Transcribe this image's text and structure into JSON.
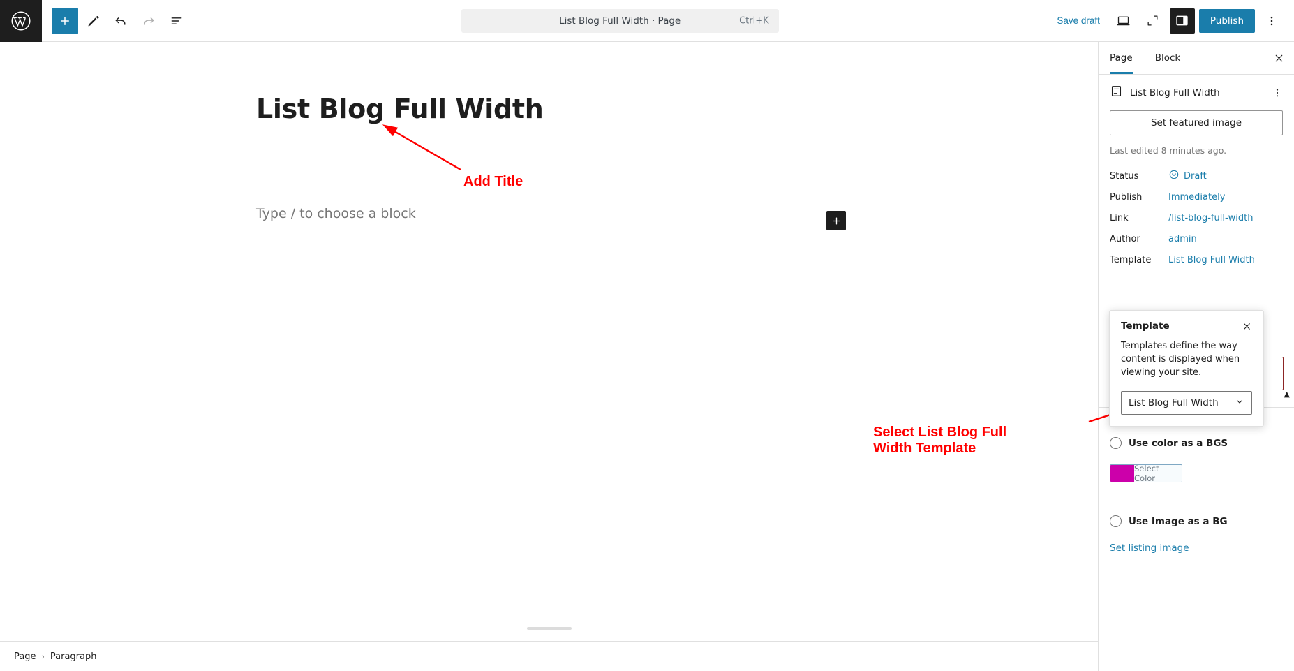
{
  "topbar": {
    "logo_icon": "wordpress-logo-icon",
    "add_block_icon": "plus-icon",
    "tools_icon": "pencil-icon",
    "undo_icon": "undo-arrow-icon",
    "redo_icon": "redo-arrow-icon",
    "list_view_icon": "list-view-icon",
    "document_title": "List Blog Full Width · Page",
    "command_shortcut": "Ctrl+K",
    "save_draft_label": "Save draft",
    "view_icon": "desktop-preview-icon",
    "fullscreen_icon": "expand-arrows-icon",
    "settings_icon": "settings-sidebar-icon",
    "publish_label": "Publish",
    "more_icon": "kebab-menu-icon"
  },
  "editor": {
    "post_title": "List Blog Full Width",
    "paragraph_placeholder": "Type / to choose a block",
    "block_inserter_icon": "plus-icon"
  },
  "annotations": [
    {
      "text": "Add Title",
      "color": "#ff0000"
    },
    {
      "text": "Select List Blog Full\nWidth Template",
      "line1": "Select List Blog Full",
      "line2": "Width Template",
      "color": "#ff0000"
    }
  ],
  "statusbar": {
    "breadcrumb": [
      "Page",
      "Paragraph"
    ],
    "separator": "›"
  },
  "sidebar": {
    "tabs": [
      {
        "label": "Page",
        "active": true
      },
      {
        "label": "Block",
        "active": false
      }
    ],
    "close_icon": "close-x-icon",
    "document_icon": "page-document-icon",
    "document_name": "List Blog Full Width",
    "kebab_icon": "kebab-menu-icon",
    "featured_image_label": "Set featured image",
    "last_edited": "Last edited 8 minutes ago.",
    "meta": [
      {
        "label": "Status",
        "value": "Draft",
        "icon": "draft-status-icon"
      },
      {
        "label": "Publish",
        "value": "Immediately",
        "icon": ""
      },
      {
        "label": "Link",
        "value": "/list-blog-full-width",
        "icon": ""
      },
      {
        "label": "Author",
        "value": "admin",
        "icon": ""
      },
      {
        "label": "Template",
        "value": "List Blog Full Width",
        "icon": ""
      }
    ],
    "collapse_icon": "chevron-up-icon",
    "bg_color_option": {
      "radio_label": "Use color as a BGS",
      "selected": false,
      "color_hex": "#cc00aa",
      "color_button_label": "Select Color"
    },
    "bg_image_option": {
      "radio_label": "Use Image as a BG",
      "selected": false,
      "set_image_link": "Set listing image"
    }
  },
  "template_popover": {
    "title": "Template",
    "close_icon": "close-x-icon",
    "description": "Templates define the way content is displayed when viewing your site.",
    "selected_template": "List Blog Full Width",
    "chevron_icon": "chevron-down-icon"
  }
}
